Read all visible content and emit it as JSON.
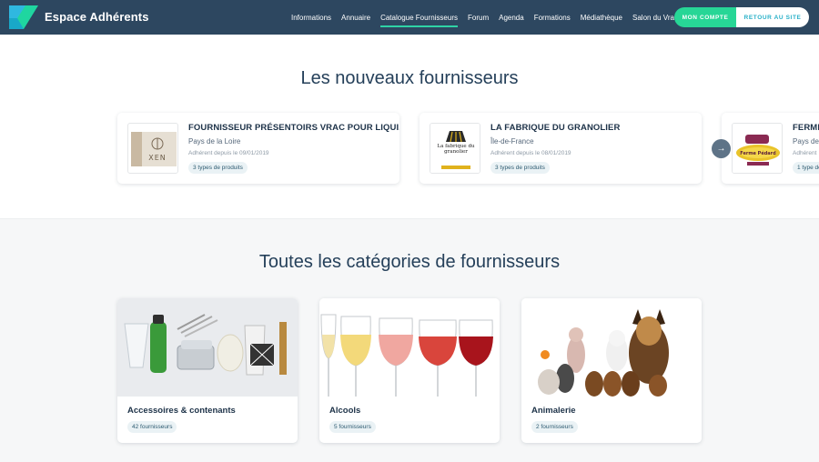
{
  "header": {
    "brand": "Espace Adhérents",
    "nav": [
      "Informations",
      "Annuaire",
      "Catalogue Fournisseurs",
      "Forum",
      "Agenda",
      "Formations",
      "Médiathèque",
      "Salon du Vrac"
    ],
    "active_index": 2,
    "account_label": "MON COMPTE",
    "return_label": "RETOUR AU SITE"
  },
  "new_suppliers": {
    "title": "Les nouveaux fournisseurs",
    "cards": [
      {
        "name": "FOURNISSEUR PRÉSENTOIRS VRAC POUR LIQUI...",
        "region": "Pays de la Loire",
        "since": "Adhérent depuis le 09/01/2019",
        "badge": "3 types de produits",
        "logo_text": "XEN"
      },
      {
        "name": "LA FABRIQUE DU GRANOLIER",
        "region": "Île-de-France",
        "since": "Adhérent depuis le 08/01/2019",
        "badge": "3 types de produits",
        "logo_text": "La fabrique du granolier"
      },
      {
        "name": "FERME",
        "region": "Pays de",
        "since": "Adhérent",
        "badge": "1 type de",
        "logo_text": "Ferme Pédard"
      }
    ],
    "next_icon": "→"
  },
  "categories": {
    "title": "Toutes les catégories de fournisseurs",
    "cards": [
      {
        "name": "Accessoires & contenants",
        "badge": "42 fournisseurs"
      },
      {
        "name": "Alcools",
        "badge": "5 fournisseurs"
      },
      {
        "name": "Animalerie",
        "badge": "2 fournisseurs"
      }
    ]
  }
}
